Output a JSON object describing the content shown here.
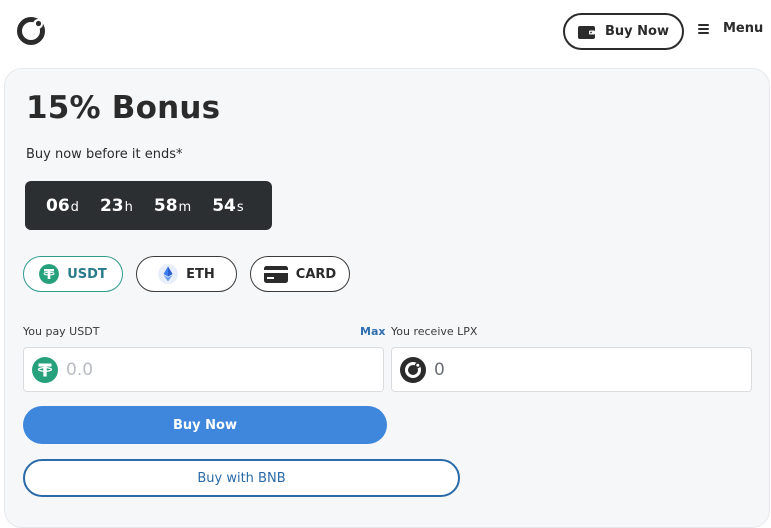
{
  "header": {
    "logo_icon": "logo-ring-icon",
    "buy_now_label": "Buy Now",
    "menu_label": "Menu"
  },
  "presale": {
    "title": "15% Bonus",
    "subtitle": "Buy now before it ends*",
    "countdown": [
      {
        "value": "06",
        "unit": "d"
      },
      {
        "value": "23",
        "unit": "h"
      },
      {
        "value": "58",
        "unit": "m"
      },
      {
        "value": "54",
        "unit": "s"
      }
    ],
    "payment_methods": [
      {
        "label": "USDT",
        "icon": "tether-icon",
        "selected": true
      },
      {
        "label": "ETH",
        "icon": "ethereum-icon",
        "selected": false
      },
      {
        "label": "CARD",
        "icon": "credit-card-icon",
        "selected": false
      }
    ],
    "pay": {
      "label": "You pay USDT",
      "max_label": "Max",
      "placeholder": "0.0",
      "icon": "tether-icon"
    },
    "receive": {
      "label": "You receive LPX",
      "value": "0",
      "icon": "lpx-token-icon"
    },
    "buy_now_label": "Buy Now",
    "buy_bnb_label": "Buy with BNB"
  },
  "colors": {
    "accent_blue": "#3f86dd",
    "outline_blue": "#2b6aa8",
    "tether_green": "#26a17b",
    "countdown_bg": "#2c2f31"
  }
}
